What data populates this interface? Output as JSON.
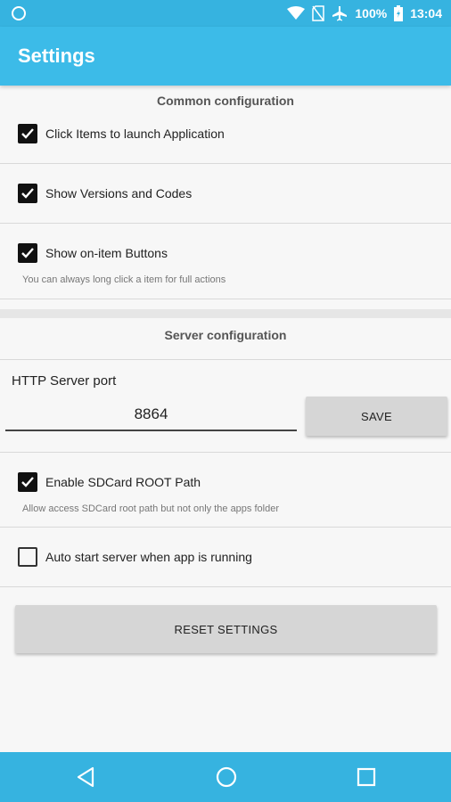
{
  "status_bar": {
    "battery_text": "100%",
    "time": "13:04",
    "icons": [
      "sync-icon",
      "wifi-icon",
      "no-sim-icon",
      "airplane-icon",
      "battery-icon"
    ]
  },
  "app_bar": {
    "title": "Settings"
  },
  "common": {
    "title": "Common configuration",
    "items": [
      {
        "label": "Click Items to launch Application",
        "checked": true
      },
      {
        "label": "Show Versions and Codes",
        "checked": true
      },
      {
        "label": "Show on-item Buttons",
        "checked": true,
        "hint": "You can always long click a item for full actions"
      }
    ]
  },
  "server": {
    "title": "Server configuration",
    "port_label": "HTTP Server port",
    "port_value": "8864",
    "save_label": "SAVE",
    "sdcard": {
      "label": "Enable SDCard ROOT Path",
      "checked": true,
      "hint": "Allow access SDCard root path but not only the apps folder"
    },
    "autostart": {
      "label": "Auto start server when app is running",
      "checked": false
    }
  },
  "reset_label": "RESET SETTINGS",
  "colors": {
    "accent": "#3cbbe8",
    "checkbox": "#111111"
  }
}
